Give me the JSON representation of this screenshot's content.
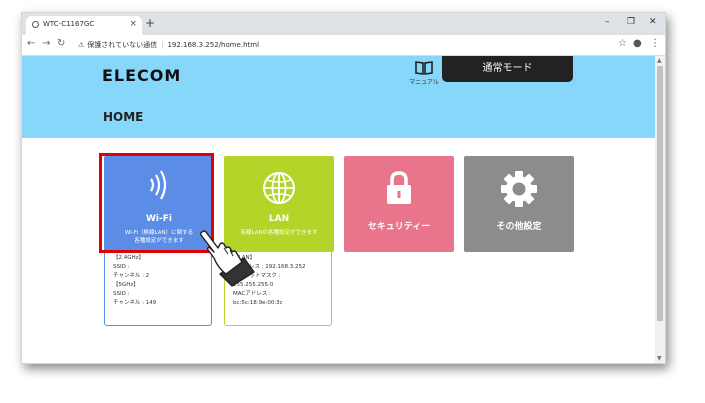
{
  "browser": {
    "tab_title": "WTC-C1167GC",
    "tab_close": "×",
    "new_tab": "+",
    "win_min": "–",
    "win_max": "❐",
    "win_close": "✕",
    "security_label": "保護されていない通信",
    "url": "192.168.3.252/home.html"
  },
  "header": {
    "logo": "ELECOM",
    "manual_label": "マニュアル",
    "mode_button": "通常モード",
    "page_title": "HOME"
  },
  "tiles": {
    "wifi": {
      "title": "Wi-Fi",
      "desc1": "Wi-Fi（無線LAN）に関する",
      "desc2": "各種設定ができます"
    },
    "lan": {
      "title": "LAN",
      "desc1": "有線LANの各種設定ができます"
    },
    "security": {
      "title": "セキュリティー"
    },
    "other": {
      "title": "その他設定"
    }
  },
  "wifi_details": {
    "band1": "【2.4GHz】",
    "ssid1": "SSID :",
    "channel1": "チャンネル : 2",
    "band2": "【5GHz】",
    "ssid2": "SSID :",
    "channel2": "チャンネル : 149"
  },
  "lan_details": {
    "heading": "【LAN】",
    "ip": "IPアドレス : 192.168.3.252",
    "mask_label": "サブネットマスク :",
    "mask_value": "255.255.255.0",
    "mac_label": "MACアドレス :",
    "mac_value": "bc:5c:18:9e:00:3c"
  },
  "colors": {
    "header_bg": "#87d7fb",
    "wifi": "#5b8de6",
    "lan": "#b3d428",
    "security": "#e9758d",
    "other": "#8c8c8c",
    "highlight": "#e00000"
  }
}
